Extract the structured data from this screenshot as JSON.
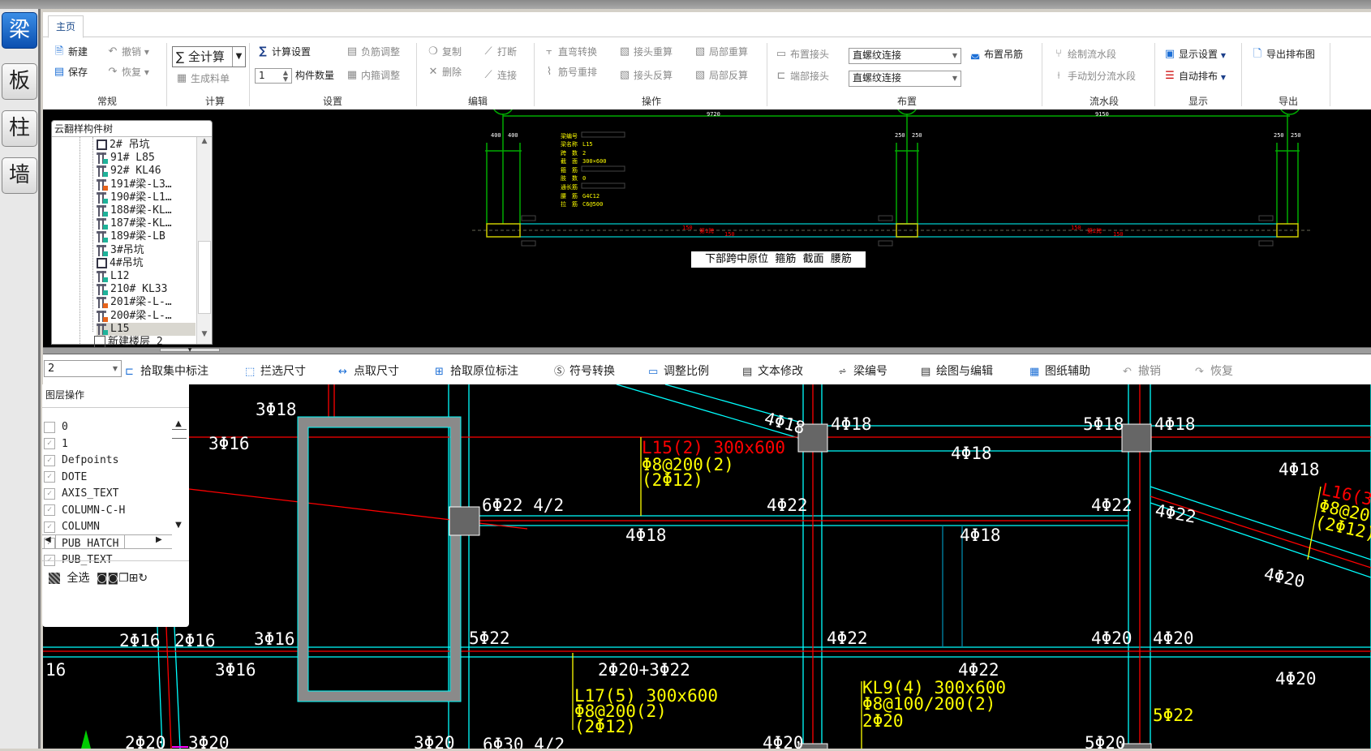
{
  "modules": [
    {
      "label": "梁",
      "active": true
    },
    {
      "label": "板"
    },
    {
      "label": "柱"
    },
    {
      "label": "墙"
    }
  ],
  "ribbon": {
    "tabs": [
      "主页"
    ],
    "groups": {
      "general": "常规",
      "calc": "计算",
      "settings": "设置",
      "edit": "编辑",
      "operate": "操作",
      "place": "布置",
      "flow": "流水段",
      "display": "显示",
      "export": "导出"
    },
    "new": "新建",
    "save": "保存",
    "undo": "撤销",
    "redo": "恢复",
    "calc_all": "全计算",
    "gen_list": "生成料单",
    "calc_settings": "计算设置",
    "qty_value": "1",
    "qty_label": "构件数量",
    "neg_adjust": "负筋调整",
    "stirrup_adjust": "内箍调整",
    "copy": "复制",
    "delete": "删除",
    "break": "打断",
    "connect": "连接",
    "bend": "直弯转换",
    "renumber": "筋号重排",
    "joint_recalc": "接头重算",
    "joint_reverse": "接头反算",
    "local_recalc": "局部重算",
    "local_reverse": "局部反算",
    "place_joint": "布置接头",
    "end_joint": "端部接头",
    "joint_type1": "直螺纹连接",
    "joint_type2": "直螺纹连接",
    "place_hanger": "布置吊筋",
    "draw_flow": "绘制流水段",
    "split_flow": "手动划分流水段",
    "display_settings": "显示设置",
    "auto_layout": "自动排布",
    "export_layout": "导出排布图"
  },
  "tree": {
    "title": "云翻样构件树",
    "items": [
      {
        "label": "2# 吊坑",
        "icon": "pit"
      },
      {
        "label": "91# L85",
        "icon": "beam",
        "badge": "teal"
      },
      {
        "label": "92# KL46",
        "icon": "beam",
        "badge": "teal"
      },
      {
        "label": "191#梁-L3…",
        "icon": "beam",
        "badge": "orange"
      },
      {
        "label": "190#梁-L1…",
        "icon": "beam",
        "badge": "teal"
      },
      {
        "label": "188#梁-KL…",
        "icon": "beam",
        "badge": "teal"
      },
      {
        "label": "187#梁-KL…",
        "icon": "beam",
        "badge": "teal"
      },
      {
        "label": "189#梁-LB",
        "icon": "beam",
        "badge": "teal"
      },
      {
        "label": "3#吊坑",
        "icon": "beam",
        "badge": "teal"
      },
      {
        "label": "4#吊坑",
        "icon": "pit"
      },
      {
        "label": "L12",
        "icon": "beam",
        "badge": "teal"
      },
      {
        "label": "210#  KL33",
        "icon": "beam",
        "badge": "teal"
      },
      {
        "label": "201#梁-L-…",
        "icon": "beam",
        "badge": "orange"
      },
      {
        "label": "200#梁-L-…",
        "icon": "beam",
        "badge": "orange"
      },
      {
        "label": "L15",
        "icon": "beam",
        "badge": "teal",
        "selected": true
      },
      {
        "label": "新建楼层 2",
        "icon": "floor"
      }
    ]
  },
  "beam_preview": {
    "dims": {
      "span1": "9720",
      "span2": "9150",
      "c1a": "400",
      "c1b": "400",
      "c2a": "250",
      "c2b": "250",
      "c3a": "250",
      "c3b": "250"
    },
    "info": [
      [
        "梁编号",
        ""
      ],
      [
        "梁名称",
        "L15"
      ],
      [
        "跨　数",
        "2"
      ],
      [
        "截　面",
        "300×600"
      ],
      [
        "箍　筋",
        ""
      ],
      [
        "肢　数",
        "0"
      ],
      [
        "通长筋",
        ""
      ],
      [
        "腰　筋",
        "G4C12"
      ],
      [
        "拉　筋",
        "C6@500"
      ]
    ],
    "span_marks": {
      "a": "150",
      "b": "第1跨",
      "c": "150",
      "d": "150",
      "e": "第2跨",
      "f": "150"
    },
    "bar": "下部跨中原位  箍筋  截面  腰筋"
  },
  "toolbar": {
    "layer_value": "2",
    "items": [
      "拾取集中标注",
      "拦选尺寸",
      "点取尺寸",
      "拾取原位标注",
      "符号转换",
      "调整比例",
      "文本修改",
      "梁编号",
      "绘图与编辑",
      "图纸辅助",
      "撤销",
      "恢复"
    ]
  },
  "layers": {
    "title": "图层操作",
    "items": [
      {
        "name": "0",
        "checked": false
      },
      {
        "name": "1",
        "checked": true
      },
      {
        "name": "Defpoints",
        "checked": true
      },
      {
        "name": "DOTE",
        "checked": true
      },
      {
        "name": "AXIS_TEXT",
        "checked": true
      },
      {
        "name": "COLUMN-C-H",
        "checked": true
      },
      {
        "name": "COLUMN",
        "checked": true
      },
      {
        "name": "PUB_HATCH",
        "checked": true
      },
      {
        "name": "PUB_TEXT",
        "checked": true
      }
    ],
    "select_all": "全选"
  },
  "drawing": {
    "white": [
      "3Φ18",
      "3Φ16",
      "6Φ22 4/2",
      "4Φ18",
      "4Φ18",
      "4Φ18",
      "5Φ18",
      "4Φ18",
      "4Φ18",
      "4Φ22",
      "4Φ22",
      "4Φ22",
      "4Φ18",
      "4Φ18",
      "4Φ20",
      "2Φ16",
      "2Φ16",
      "3Φ16",
      "16",
      "3Φ16",
      "5Φ22",
      "4Φ22",
      "4Φ20",
      "4Φ20",
      "2Φ20+3Φ22",
      "4Φ22",
      "4Φ20",
      "5Φ22",
      "2Φ20",
      "3Φ20",
      "3Φ20",
      "6Φ30 4/2",
      "4Φ20",
      "5Φ20"
    ],
    "l15": [
      "L15(2) 300x600",
      "Φ8@200(2)",
      "(2Φ12)"
    ],
    "l17": [
      "L17(5) 300x600",
      "Φ8@200(2)",
      "(2Φ12)"
    ],
    "kl9": [
      "KL9(4) 300x600",
      "Φ8@100/200(2)",
      "2Φ20"
    ],
    "l16": [
      "L16(3",
      "Φ8@20",
      "(2Φ12)"
    ]
  },
  "colors": {
    "accent": "#0b4fb0",
    "canvas": "#000000",
    "cyan": "#00ffff",
    "red": "#ff0000",
    "yellow": "#ffff00",
    "column": "#666666"
  }
}
